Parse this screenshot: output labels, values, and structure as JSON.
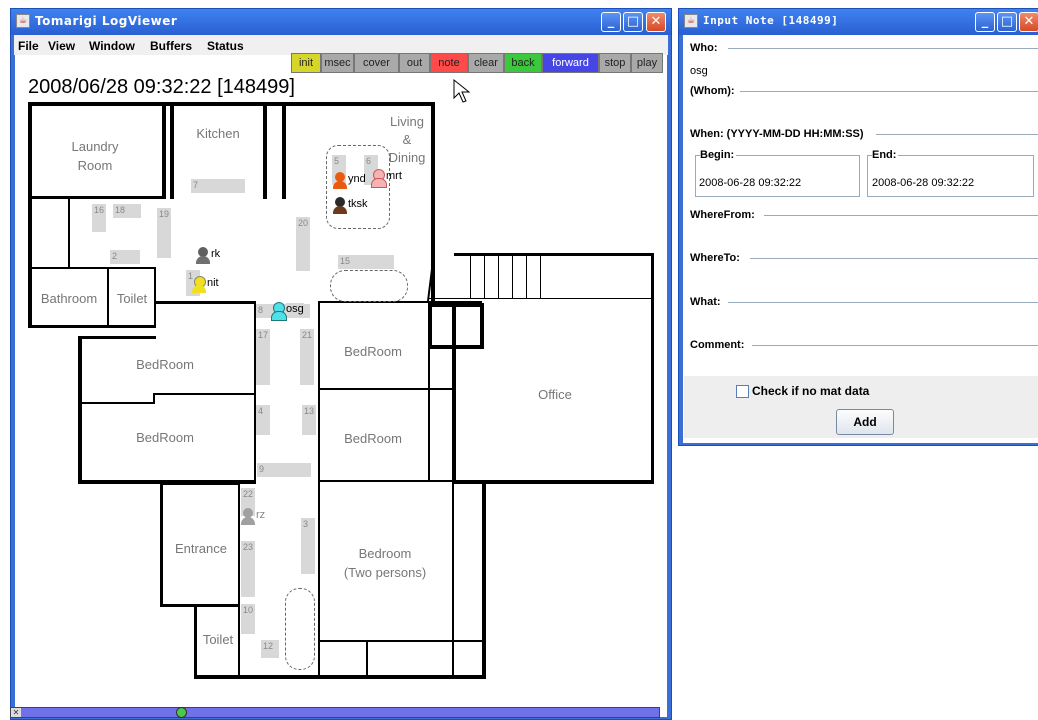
{
  "main_window": {
    "title": "Tomarigi LogViewer",
    "menu": [
      "File",
      "View",
      "Window",
      "Buffers",
      "Status"
    ],
    "toolbar": [
      {
        "label": "init",
        "color": "#d6d62a"
      },
      {
        "label": "msec",
        "color": "#a9a9a9"
      },
      {
        "label": "cover",
        "color": "#a9a9a9"
      },
      {
        "label": "out",
        "color": "#a9a9a9"
      },
      {
        "label": "note",
        "color": "#ff4a4a"
      },
      {
        "label": "clear",
        "color": "#a9a9a9"
      },
      {
        "label": "back",
        "color": "#3cc83c"
      },
      {
        "label": "forward",
        "color": "#4646e6"
      },
      {
        "label": "stop",
        "color": "#a9a9a9"
      },
      {
        "label": "play",
        "color": "#a9a9a9"
      }
    ],
    "timestamp": "2008/06/28 09:32:22 [148499]",
    "rooms": {
      "laundry_line1": "Laundry",
      "laundry_line2": "Room",
      "kitchen": "Kitchen",
      "living_line1": "Living",
      "living_line2": "&",
      "living_line3": "Dining",
      "bathroom": "Bathroom",
      "toilet": "Toilet",
      "bedroom1": "BedRoom",
      "bedroom2": "BedRoom",
      "bedroom3": "BedRoom",
      "bedroom4": "BedRoom",
      "office": "Office",
      "entrance": "Entrance",
      "toilet2": "Toilet",
      "bedroom_two_line1": "Bedroom",
      "bedroom_two_line2": "(Two persons)"
    },
    "sensors": {
      "s7": "7",
      "s16": "16",
      "s18": "18",
      "s19": "19",
      "s2": "2",
      "s20": "20",
      "s5": "5",
      "s6": "6",
      "s15": "15",
      "s1": "1",
      "s8": "8",
      "s17": "17",
      "s21": "21",
      "s4": "4",
      "s13": "13",
      "s9": "9",
      "s22": "22",
      "s3": "3",
      "s23": "23",
      "s10": "10",
      "s12": "12"
    },
    "people": {
      "ynd": "ynd",
      "mrt": "mrt",
      "tksk": "tksk",
      "rk": "rk",
      "nit": "nit",
      "osg": "osg",
      "rz": "rz"
    },
    "person_colors": {
      "ynd": "#e85c10",
      "mrt": "#f4b4b4",
      "tksk": "#6a3a1a",
      "rk": "#707070",
      "nit": "#f0e020",
      "osg": "#50e0e8",
      "rz": "#a0a0a0"
    },
    "scroll_icon": "close-x-icon"
  },
  "note_window": {
    "title": "Input Note [148499]",
    "who_label": "Who:",
    "who_value": "osg",
    "whom_label": "(Whom):",
    "when_label": "When: (YYYY-MM-DD HH:MM:SS)",
    "begin_label": "Begin:",
    "begin_value": "2008-06-28 09:32:22",
    "end_label": "End:",
    "end_value": "2008-06-28 09:32:22",
    "wherefrom_label": "WhereFrom:",
    "whereto_label": "WhereTo:",
    "what_label": "What:",
    "comment_label": "Comment:",
    "checkbox_label": "Check if no mat data",
    "add_label": "Add"
  }
}
